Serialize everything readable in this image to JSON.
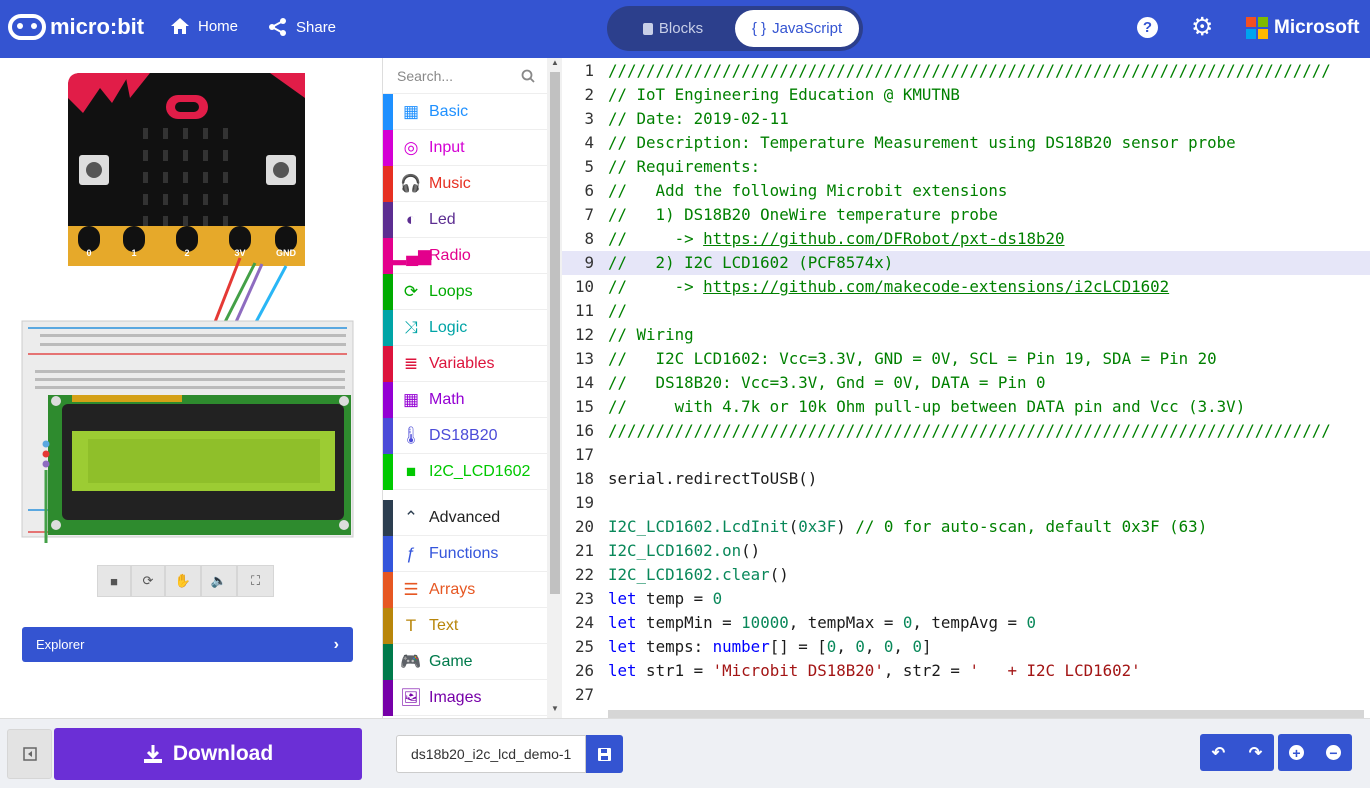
{
  "header": {
    "brand": "micro:bit",
    "home_label": "Home",
    "share_label": "Share",
    "blocks_label": "Blocks",
    "js_label": "JavaScript",
    "ms_label": "Microsoft"
  },
  "simulator": {
    "pins": [
      "0",
      "1",
      "2",
      "3V",
      "GND"
    ],
    "explorer_label": "Explorer"
  },
  "toolbox": {
    "search_placeholder": "Search...",
    "categories": [
      {
        "label": "Basic",
        "color": "#1e90ff",
        "icon": "grid-icon"
      },
      {
        "label": "Input",
        "color": "#d400d4",
        "icon": "target-icon"
      },
      {
        "label": "Music",
        "color": "#e63022",
        "icon": "headphones-icon"
      },
      {
        "label": "Led",
        "color": "#5c2d91",
        "icon": "toggle-icon"
      },
      {
        "label": "Radio",
        "color": "#e3008c",
        "icon": "signal-icon"
      },
      {
        "label": "Loops",
        "color": "#00aa00",
        "icon": "refresh-icon"
      },
      {
        "label": "Logic",
        "color": "#00a4a6",
        "icon": "shuffle-icon"
      },
      {
        "label": "Variables",
        "color": "#dc143c",
        "icon": "list-icon"
      },
      {
        "label": "Math",
        "color": "#9400d3",
        "icon": "calculator-icon"
      },
      {
        "label": "DS18B20",
        "color": "#4b4bd8",
        "icon": "thermometer-icon"
      },
      {
        "label": "I2C_LCD1602",
        "color": "#00c800",
        "icon": "square-icon"
      },
      {
        "label": "Advanced",
        "color": "#2c3e50",
        "icon": "chevron-up-icon"
      },
      {
        "label": "Functions",
        "color": "#3455db",
        "icon": "function-icon"
      },
      {
        "label": "Arrays",
        "color": "#e65722",
        "icon": "arrays-icon"
      },
      {
        "label": "Text",
        "color": "#b8860b",
        "icon": "text-icon"
      },
      {
        "label": "Game",
        "color": "#007a4b",
        "icon": "gamepad-icon"
      },
      {
        "label": "Images",
        "color": "#7600a8",
        "icon": "image-icon"
      }
    ]
  },
  "editor": {
    "lines": [
      "1",
      "2",
      "3",
      "4",
      "5",
      "6",
      "7",
      "8",
      "9",
      "10",
      "11",
      "12",
      "13",
      "14",
      "15",
      "16",
      "17",
      "18",
      "19",
      "20",
      "21",
      "22",
      "23",
      "24",
      "25",
      "26",
      "27"
    ],
    "code": {
      "l1": "////////////////////////////////////////////////////////////////////////////",
      "l2": "// IoT Engineering Education @ KMUTNB",
      "l3": "// Date: 2019-02-11",
      "l4": "// Description: Temperature Measurement using DS18B20 sensor probe",
      "l5": "// Requirements:",
      "l6": "//   Add the following Microbit extensions",
      "l7": "//   1) DS18B20 OneWire temperature probe",
      "l8a": "//     -> ",
      "l8b": "https://github.com/DFRobot/pxt-ds18b20",
      "l9": "//   2) I2C LCD1602 (PCF8574x)",
      "l10a": "//     -> ",
      "l10b": "https://github.com/makecode-extensions/i2cLCD1602",
      "l11": "//",
      "l12": "// Wiring",
      "l13": "//   I2C LCD1602: Vcc=3.3V, GND = 0V, SCL = Pin 19, SDA = Pin 20",
      "l14": "//   DS18B20: Vcc=3.3V, Gnd = 0V, DATA = Pin 0",
      "l15": "//     with 4.7k or 10k Ohm pull-up between DATA pin and Vcc (3.3V)",
      "l16": "////////////////////////////////////////////////////////////////////////////",
      "l18": "serial.redirectToUSB()",
      "l20a": "I2C_LCD1602.",
      "l20b": "LcdInit",
      "l20c": "(",
      "l20d": "0x3F",
      "l20e": ") ",
      "l20f": "// 0 for auto-scan, default 0x3F (63)",
      "l21a": "I2C_LCD1602.",
      "l21b": "on",
      "l21c": "()",
      "l22a": "I2C_LCD1602.",
      "l22b": "clear",
      "l22c": "()",
      "l23a": "let",
      "l23b": " temp = ",
      "l23c": "0",
      "l24a": "let",
      "l24b": " tempMin = ",
      "l24c": "10000",
      "l24d": ", tempMax = ",
      "l24e": "0",
      "l24f": ", tempAvg = ",
      "l24g": "0",
      "l25a": "let",
      "l25b": " temps: ",
      "l25c": "number",
      "l25d": "[] = [",
      "l25e": "0",
      "l25f": ", ",
      "l25g": "0",
      "l25h": ", ",
      "l25i": "0",
      "l25j": ", ",
      "l25k": "0",
      "l25l": "]",
      "l26a": "let",
      "l26b": " str1 = ",
      "l26c": "'Microbit DS18B20'",
      "l26d": ", str2 = ",
      "l26e": "'   + I2C LCD1602'"
    }
  },
  "footer": {
    "download_label": "Download",
    "filename_value": "ds18b20_i2c_lcd_demo-1"
  }
}
